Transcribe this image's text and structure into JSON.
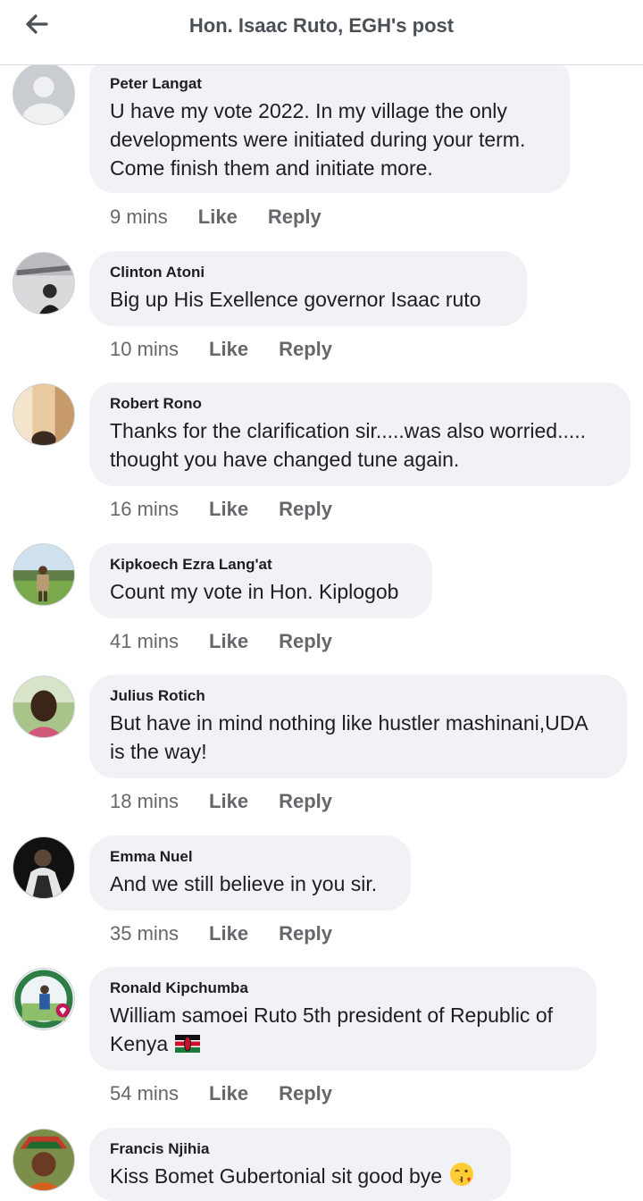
{
  "header": {
    "title": "Hon. Isaac Ruto, EGH's post"
  },
  "actions": {
    "like": "Like",
    "reply": "Reply"
  },
  "comments": [
    {
      "author": "Peter Langat",
      "text": "U have my vote 2022. In my village the only developments were initiated during your term. Come finish them and initiate more.",
      "time": "9 mins",
      "avatar": "default-avatar-icon"
    },
    {
      "author": "Clinton Atoni",
      "text": "Big up  His Exellence  governor Isaac ruto",
      "time": "10 mins",
      "avatar": "profile-photo"
    },
    {
      "author": "Robert Rono",
      "text": "Thanks for the clarification sir.....was also worried..... thought you have changed tune again.",
      "time": "16 mins",
      "avatar": "profile-photo"
    },
    {
      "author": "Kipkoech Ezra Lang'at",
      "text": "Count my vote in Hon. Kiplogob",
      "time": "41 mins",
      "avatar": "profile-photo"
    },
    {
      "author": "Julius Rotich",
      "text": "But have in mind nothing like hustler mashinani,UDA is the way!",
      "time": "18 mins",
      "avatar": "profile-photo"
    },
    {
      "author": "Emma Nuel",
      "text": "And we still believe in you sir.",
      "time": "35 mins",
      "avatar": "profile-photo"
    },
    {
      "author": "Ronald Kipchumba",
      "text": "William samoei Ruto 5th president of Republic of Kenya",
      "time": "54 mins",
      "avatar": "profile-photo",
      "emoji": "kenya-flag-icon"
    },
    {
      "author": "Francis Njihia",
      "text": "Kiss Bomet Gubertonial sit good bye",
      "time": "",
      "avatar": "profile-photo",
      "emoji": "kissing-face-icon"
    }
  ]
}
